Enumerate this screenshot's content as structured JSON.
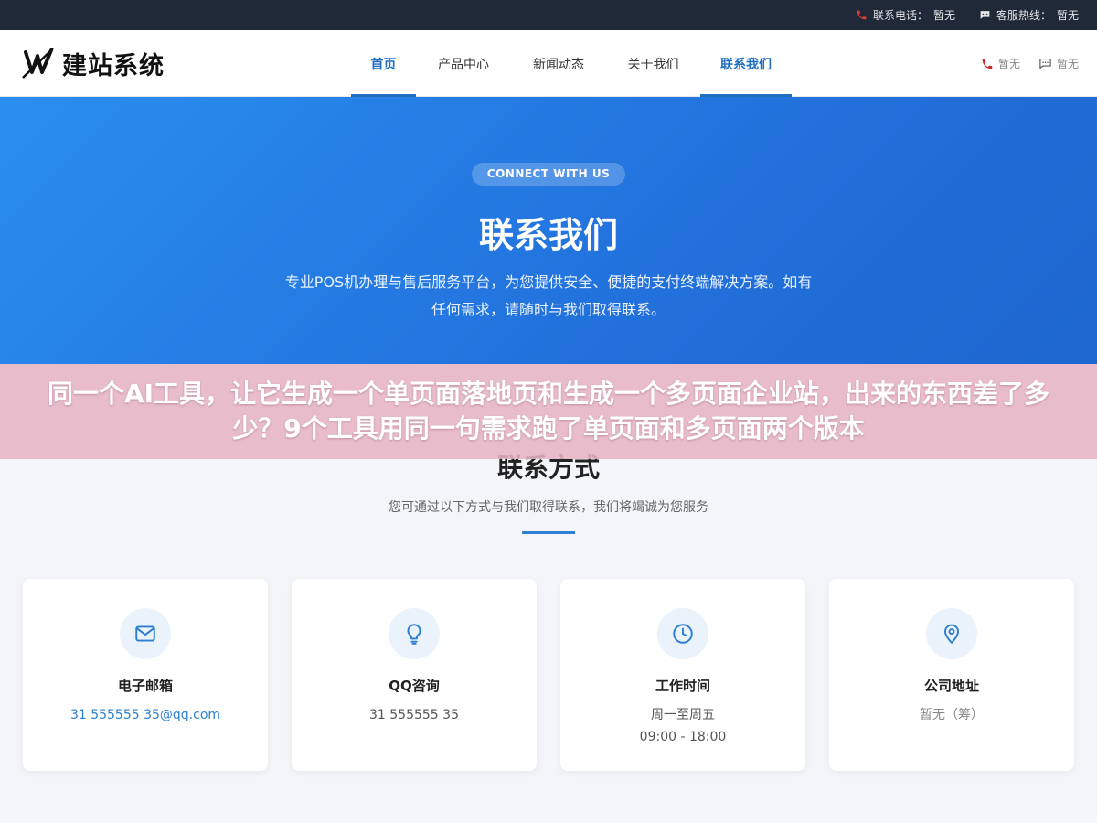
{
  "topbar": {
    "phone_label": "联系电话：",
    "phone_value": "暂无",
    "hotline_label": "客服热线：",
    "hotline_value": "暂无"
  },
  "header": {
    "logo_text": "建站系统",
    "nav": [
      {
        "label": "首页",
        "active": true
      },
      {
        "label": "产品中心",
        "active": false
      },
      {
        "label": "新闻动态",
        "active": false
      },
      {
        "label": "关于我们",
        "active": false
      },
      {
        "label": "联系我们",
        "active": true
      }
    ],
    "right_phone": "暂无",
    "right_chat": "暂无"
  },
  "hero": {
    "pill": "CONNECT WITH US",
    "title": "联系我们",
    "description": "专业POS机办理与售后服务平台，为您提供安全、便捷的支付终端解决方案。如有任何需求，请随时与我们取得联系。"
  },
  "overlay": {
    "text": "同一个AI工具，让它生成一个单页面落地页和生成一个多页面企业站，出来的东西差了多少？9个工具用同一句需求跑了单页面和多页面两个版本"
  },
  "section": {
    "title": "联系方式",
    "subtitle": "您可通过以下方式与我们取得联系，我们将竭诚为您服务"
  },
  "cards": [
    {
      "icon": "mail-icon",
      "title": "电子邮箱",
      "value": "31 555555 35@qq.com",
      "value2": ""
    },
    {
      "icon": "lightbulb-icon",
      "title": "QQ咨询",
      "value": "31 555555 35",
      "value2": ""
    },
    {
      "icon": "clock-icon",
      "title": "工作时间",
      "value": "周一至周五",
      "value2": "09:00 - 18:00"
    },
    {
      "icon": "location-pin-icon",
      "title": "公司地址",
      "value": "暂无（筹）",
      "value2": ""
    }
  ],
  "colors": {
    "accent": "#1f6ec0",
    "hero_start": "#2a8ef0",
    "hero_end": "#1e66d0",
    "topbar_bg": "#1f2937",
    "overlay": "#e6b4c3"
  }
}
